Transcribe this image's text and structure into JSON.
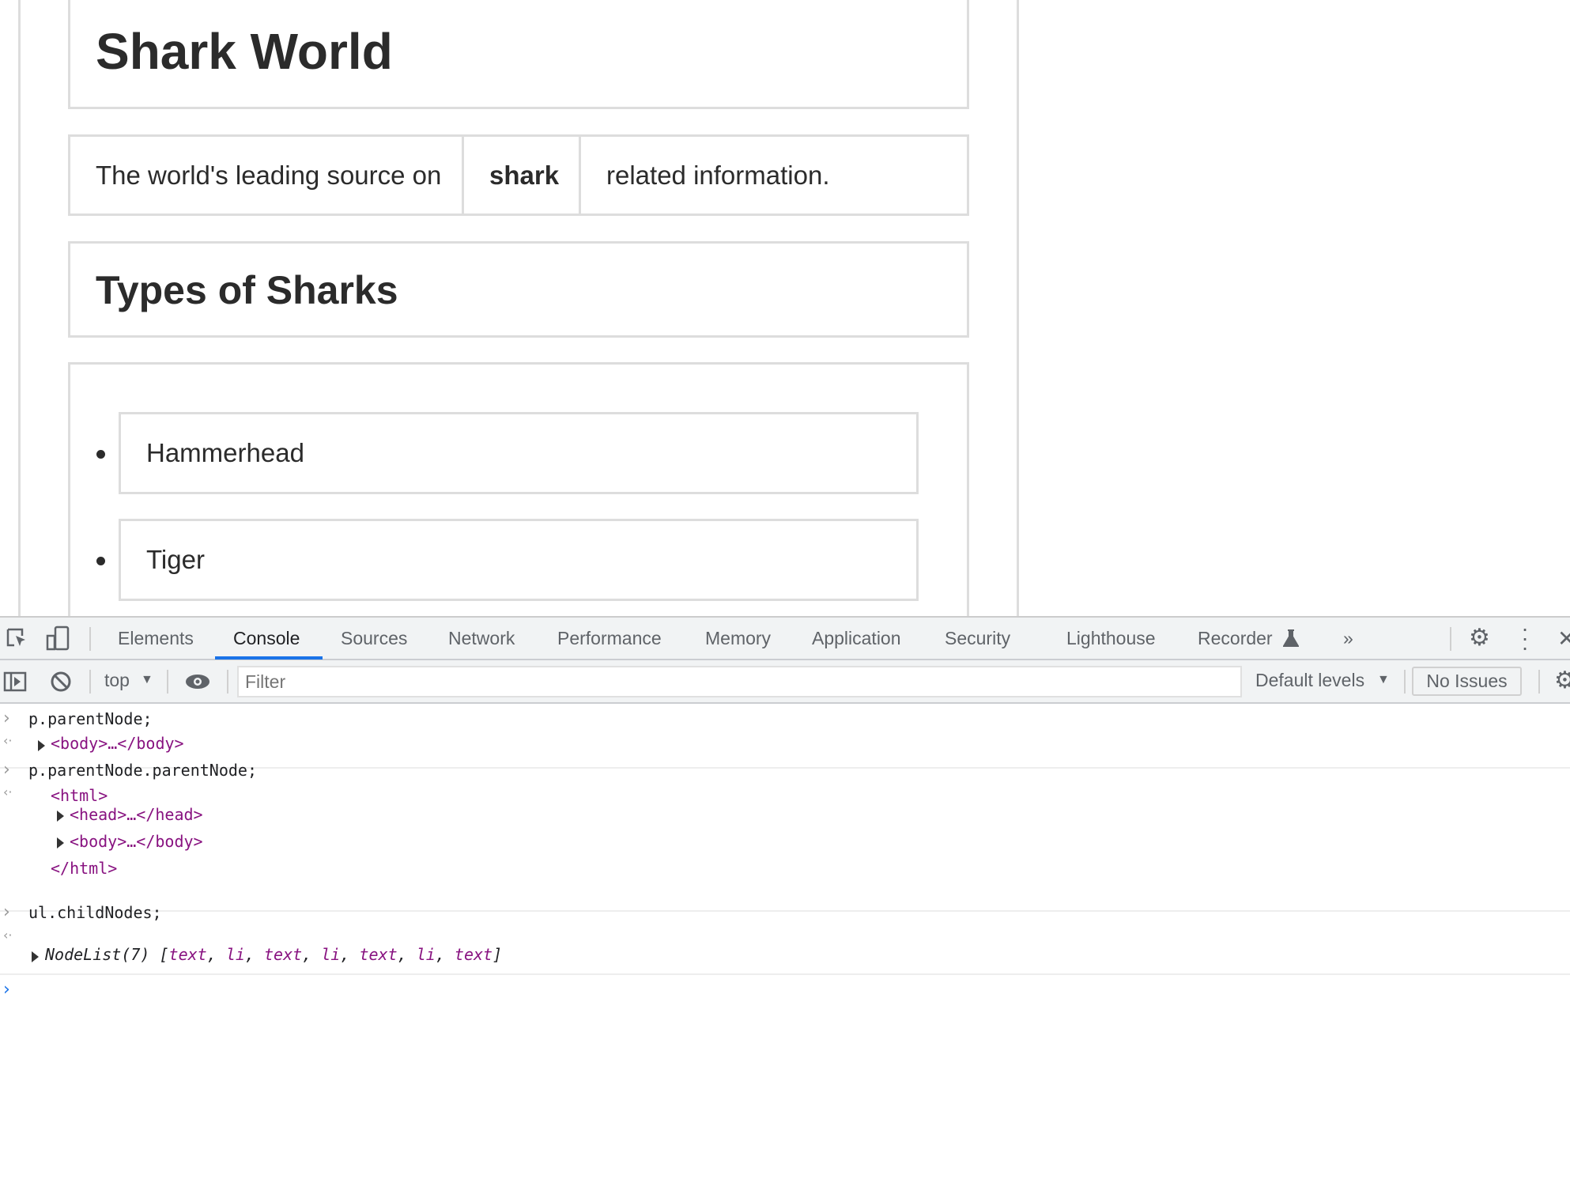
{
  "page": {
    "title": "Shark World",
    "tagline": [
      "The world's leading source on",
      "shark",
      "related information."
    ],
    "section_heading": "Types of Sharks",
    "list_items": [
      "Hammerhead",
      "Tiger"
    ]
  },
  "devtools": {
    "tabs": [
      "Elements",
      "Console",
      "Sources",
      "Network",
      "Performance",
      "Memory",
      "Application",
      "Security",
      "Lighthouse",
      "Recorder"
    ],
    "active_tab": "Console",
    "more_tabs": "»",
    "toolbar": {
      "context": "top",
      "filter_placeholder": "Filter",
      "levels": "Default levels",
      "issues": "No Issues"
    },
    "console": [
      {
        "input": "p.parentNode;",
        "output": [
          "<body>…</body>"
        ]
      },
      {
        "input": "p.parentNode.parentNode;",
        "output": [
          "<html>",
          "<head>…</head>",
          "<body>…</body>",
          "</html>"
        ]
      },
      {
        "input": "ul.childNodes;",
        "output_prefix": "NodeList(7) [",
        "items": [
          "text",
          "li",
          "text",
          "li",
          "text",
          "li",
          "text"
        ],
        "output_suffix": "]"
      }
    ],
    "accent": "#1a73e8"
  }
}
